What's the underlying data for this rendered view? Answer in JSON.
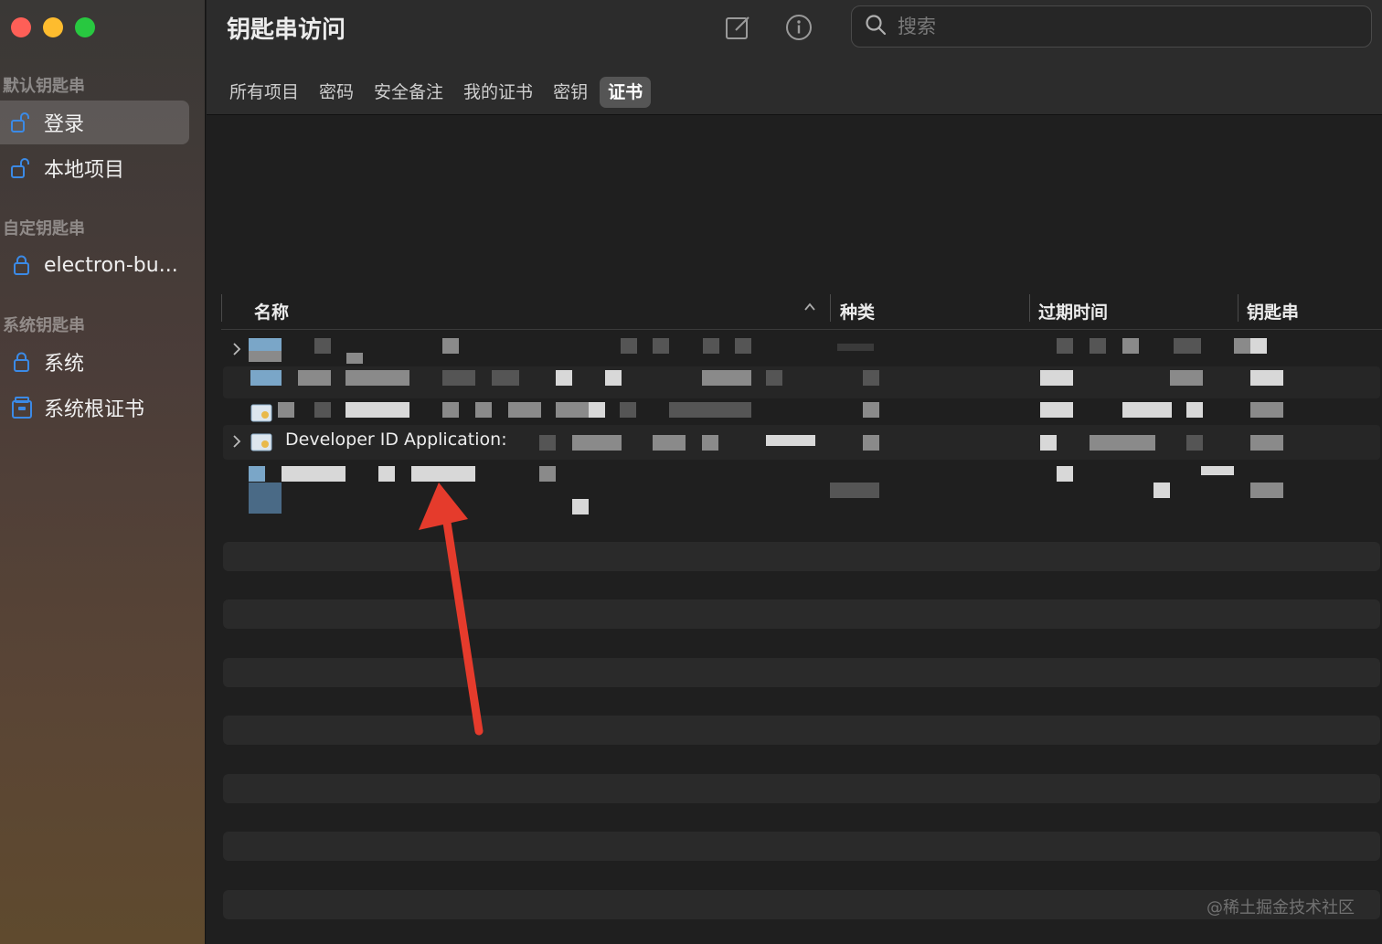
{
  "app": {
    "title": "钥匙串访问"
  },
  "sidebar": {
    "sections": [
      {
        "title": "默认钥匙串",
        "items": [
          {
            "label": "登录",
            "icon": "unlocked-icon",
            "selected": true
          },
          {
            "label": "本地项目",
            "icon": "unlocked-icon"
          }
        ]
      },
      {
        "title": "自定钥匙串",
        "items": [
          {
            "label": "electron-bu...",
            "icon": "lock-icon"
          }
        ]
      },
      {
        "title": "系统钥匙串",
        "items": [
          {
            "label": "系统",
            "icon": "lock-icon"
          },
          {
            "label": "系统根证书",
            "icon": "cabinet-icon"
          }
        ]
      }
    ]
  },
  "toolbar": {
    "new_icon": "compose-icon",
    "info_icon": "info-icon",
    "search_placeholder": "搜索"
  },
  "tabs": [
    {
      "label": "所有项目"
    },
    {
      "label": "密码"
    },
    {
      "label": "安全备注"
    },
    {
      "label": "我的证书"
    },
    {
      "label": "密钥"
    },
    {
      "label": "证书",
      "active": true
    }
  ],
  "table": {
    "columns": [
      "名称",
      "种类",
      "过期时间",
      "钥匙串"
    ],
    "visible_row_name": "Developer ID Application:"
  },
  "colors": {
    "accent_icon": "#3b8ae6",
    "annotation_arrow": "#e53b2c"
  },
  "watermark": "@稀土掘金技术社区"
}
